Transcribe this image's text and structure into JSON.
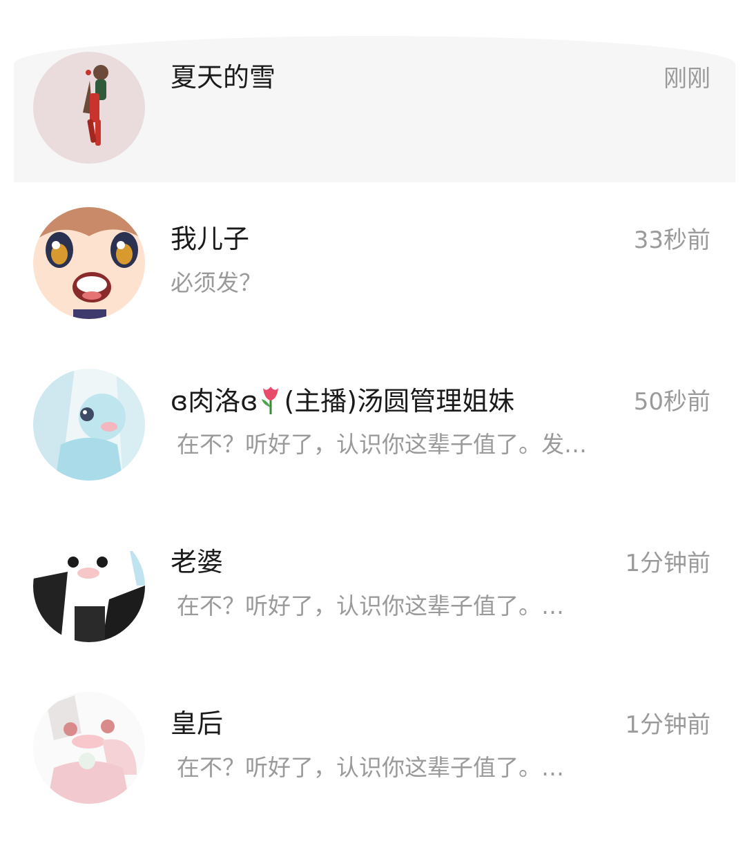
{
  "conversations": [
    {
      "name": "夏天的雪",
      "time": "刚刚",
      "preview": "",
      "avatar_icon": "avatar-girl-red-outfit-icon"
    },
    {
      "name": "我儿子",
      "time": "33秒前",
      "preview": "必须发？",
      "avatar_icon": "avatar-anime-face-icon"
    },
    {
      "name_prefix": "ɞ肉洛ɞ",
      "name_emoji": "tulip-emoji",
      "name_suffix": "(主播)汤圆管理姐妹",
      "time": "50秒前",
      "preview": "在不？听好了，认识你这辈子值了。发…",
      "avatar_icon": "avatar-blue-hair-girl-icon"
    },
    {
      "name": "老婆",
      "time": "1分钟前",
      "preview": "在不？听好了，认识你这辈子值了。…",
      "avatar_icon": "avatar-white-hair-maid-icon"
    },
    {
      "name": "皇后",
      "time": "1分钟前",
      "preview": "在不？听好了，认识你这辈子值了。…",
      "avatar_icon": "avatar-pink-girl-icon"
    }
  ],
  "colors": {
    "name": "#1a1a1a",
    "secondary": "#9a9a9a",
    "highlight_bg": "#f6f6f6"
  }
}
